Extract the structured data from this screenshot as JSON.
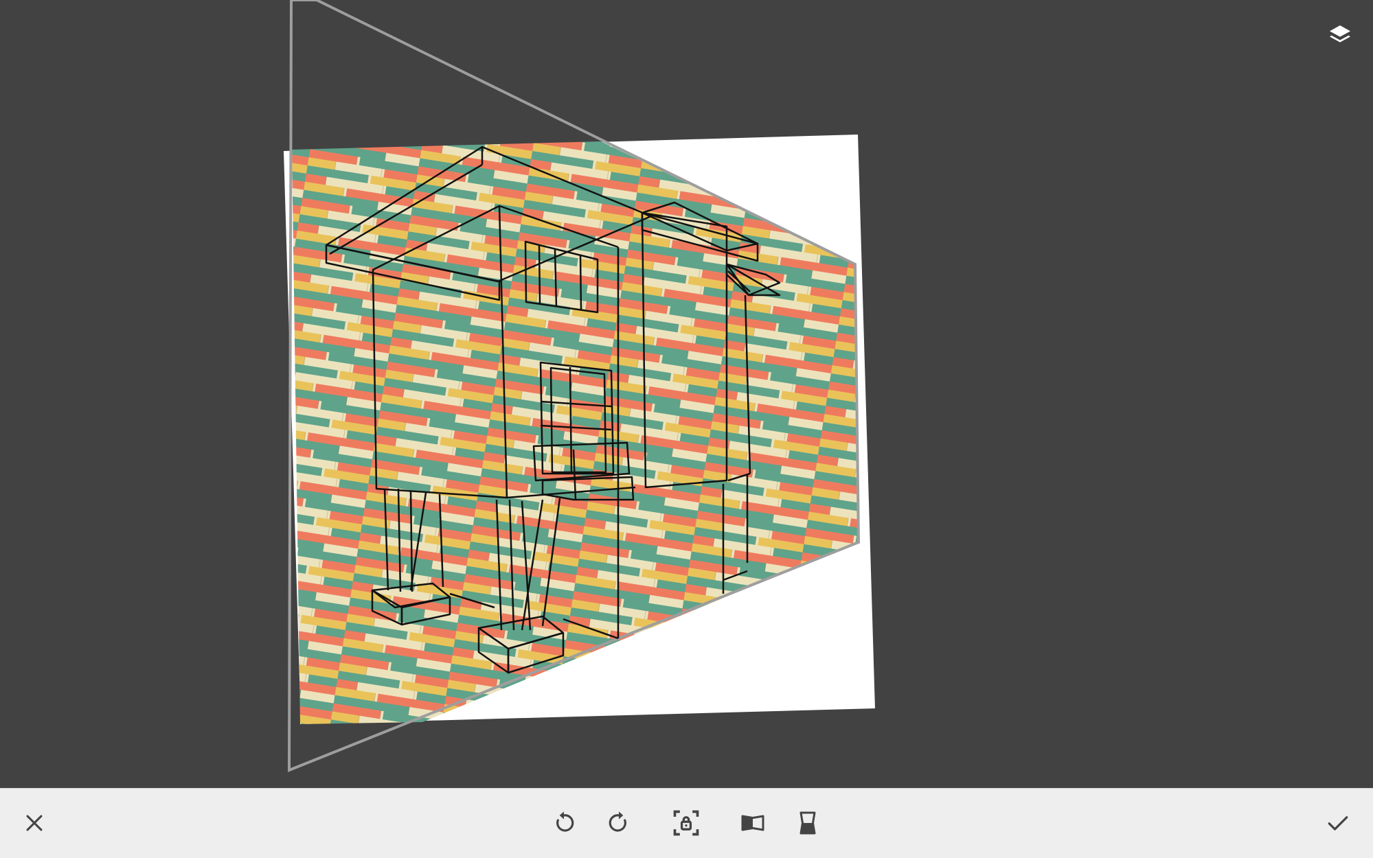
{
  "editor": {
    "tool": "perspective-transform",
    "layers_icon": "layers-icon"
  },
  "toolbar": {
    "cancel_icon": "close-icon",
    "apply_icon": "check-icon",
    "tools": [
      {
        "name": "rotate-left-icon"
      },
      {
        "name": "rotate-right-icon"
      },
      {
        "name": "aspect-lock-icon"
      },
      {
        "name": "perspective-horizontal-icon"
      },
      {
        "name": "perspective-vertical-icon"
      }
    ]
  },
  "colors": {
    "workspace": "#424242",
    "toolbar": "#eeeeee",
    "icon_dark": "#444444",
    "icon_light": "#ffffff",
    "frame": "#9e9e9e",
    "plank_palette": [
      "#ef7b5f",
      "#e9c35a",
      "#5fa38a",
      "#ece3bd"
    ]
  }
}
